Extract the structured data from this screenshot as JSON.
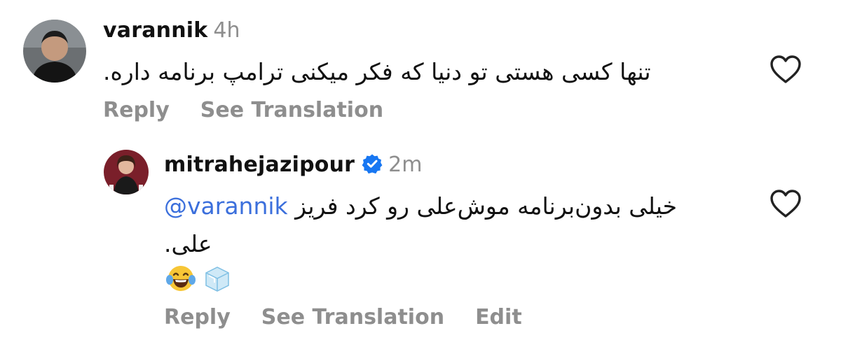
{
  "comments": [
    {
      "username": "varannik",
      "time": "4h",
      "text": "تنها کسی هستی تو دنیا که فکر میکنی ترامپ برنامه داره.",
      "actions": {
        "reply": "Reply",
        "translate": "See Translation"
      },
      "icons": {
        "avatar": "avatar-photo",
        "like": "heart-outline-icon"
      }
    },
    {
      "username": "mitrahejazipour",
      "verified": true,
      "time": "2m",
      "mention": "@varannik",
      "text_line1": "خیلی بدون‌برنامه موش‌علی رو کرد فریز",
      "text_line2": "علی.",
      "emoji_names": [
        "face-with-tears-of-joy",
        "ice-cube"
      ],
      "actions": {
        "reply": "Reply",
        "translate": "See Translation",
        "edit": "Edit"
      },
      "icons": {
        "avatar": "avatar-photo",
        "verified": "verified-badge-icon",
        "like": "heart-outline-icon"
      }
    }
  ],
  "colors": {
    "text": "#111111",
    "muted": "#8e8e8e",
    "mention": "#3b6fdc",
    "verified": "#1877f2"
  }
}
